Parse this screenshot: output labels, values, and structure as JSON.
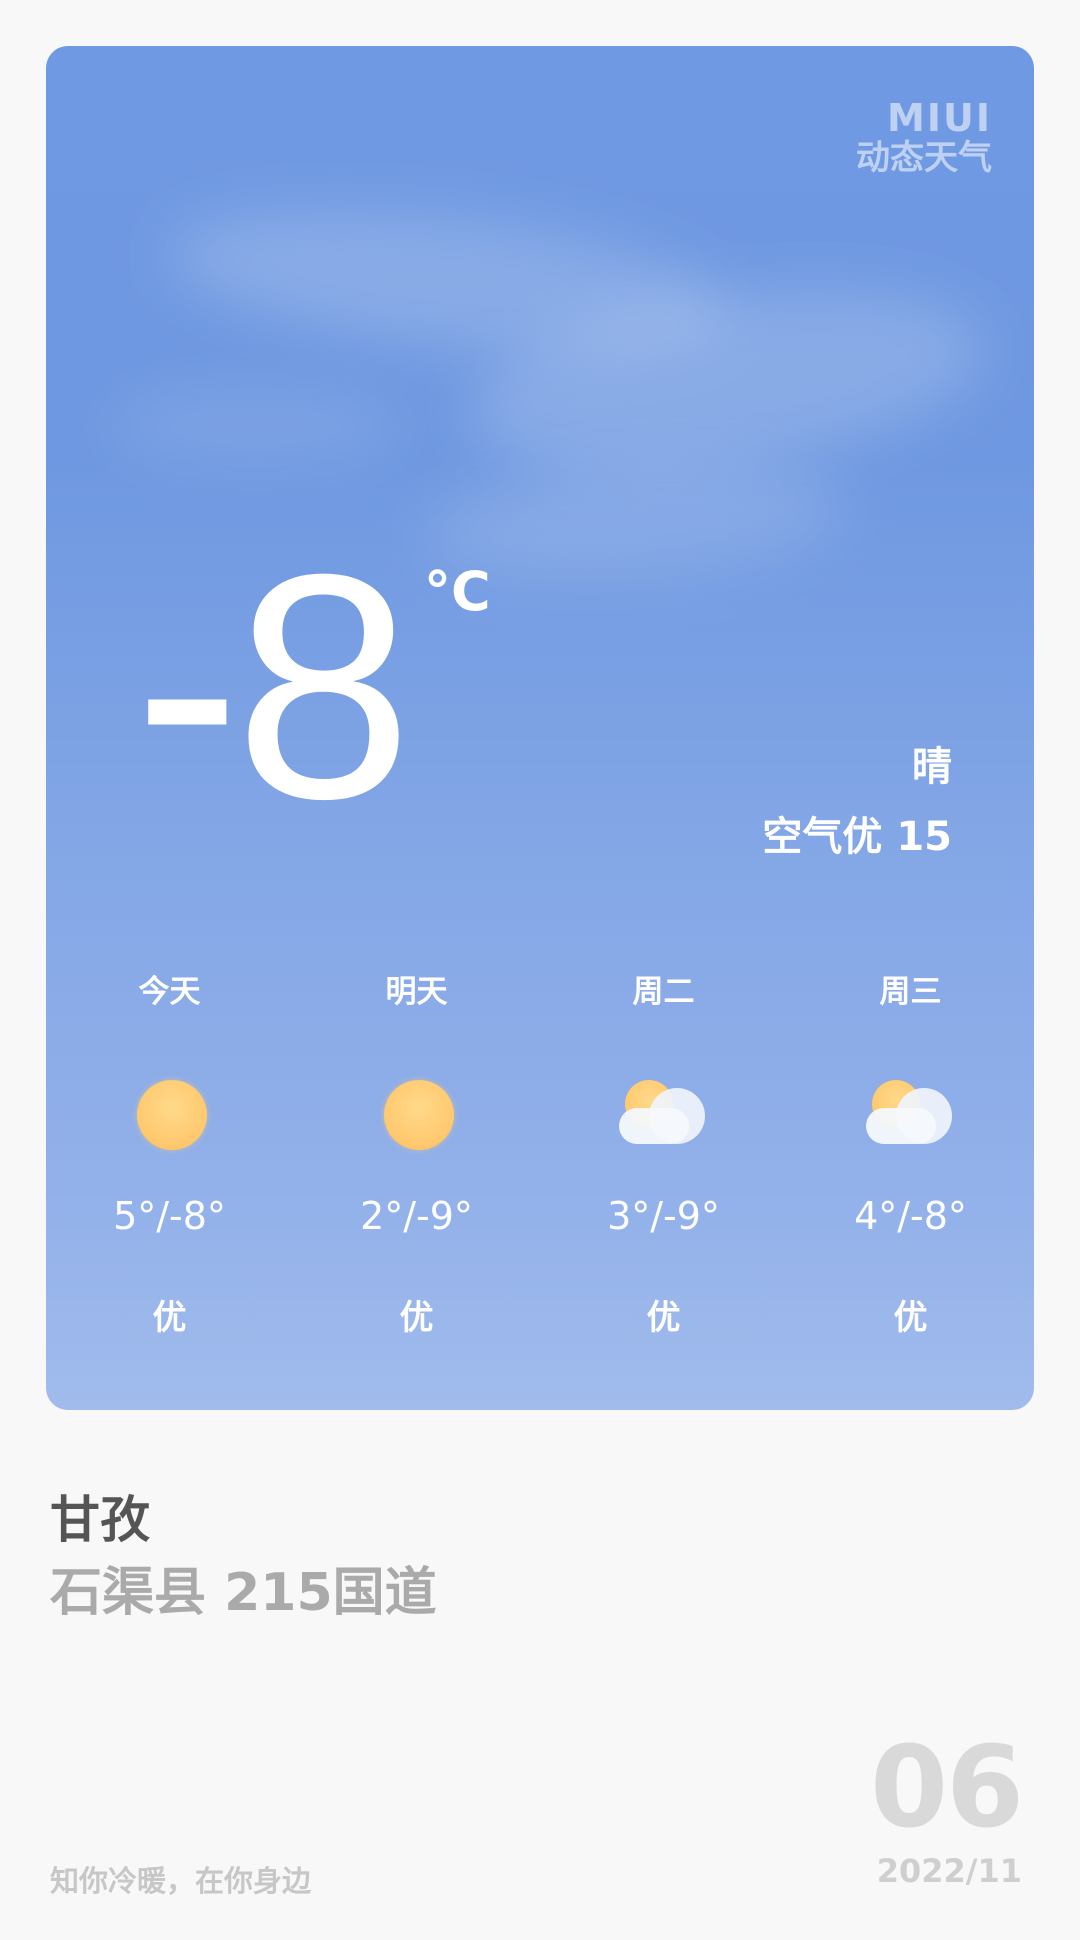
{
  "brand": {
    "line1": "MIUI",
    "line2": "动态天气"
  },
  "current": {
    "temperature": "-8",
    "unit": "°C",
    "condition": "晴",
    "air_quality": "空气优 15"
  },
  "forecast": [
    {
      "day": "今天",
      "icon": "sun-icon",
      "range": "5°/-8°",
      "air": "优"
    },
    {
      "day": "明天",
      "icon": "sun-icon",
      "range": "2°/-9°",
      "air": "优"
    },
    {
      "day": "周二",
      "icon": "partly-cloudy-icon",
      "range": "3°/-9°",
      "air": "优"
    },
    {
      "day": "周三",
      "icon": "partly-cloudy-icon",
      "range": "4°/-8°",
      "air": "优"
    }
  ],
  "location": {
    "city": "甘孜",
    "street": "石渠县 215国道"
  },
  "footer": {
    "slogan": "知你冷暖，在你身边",
    "day": "06",
    "year_month": "2022/11"
  },
  "colors": {
    "sky_top": "#6f99e2",
    "sky_bottom": "#a1bbec",
    "sun": "#ffc86d"
  }
}
